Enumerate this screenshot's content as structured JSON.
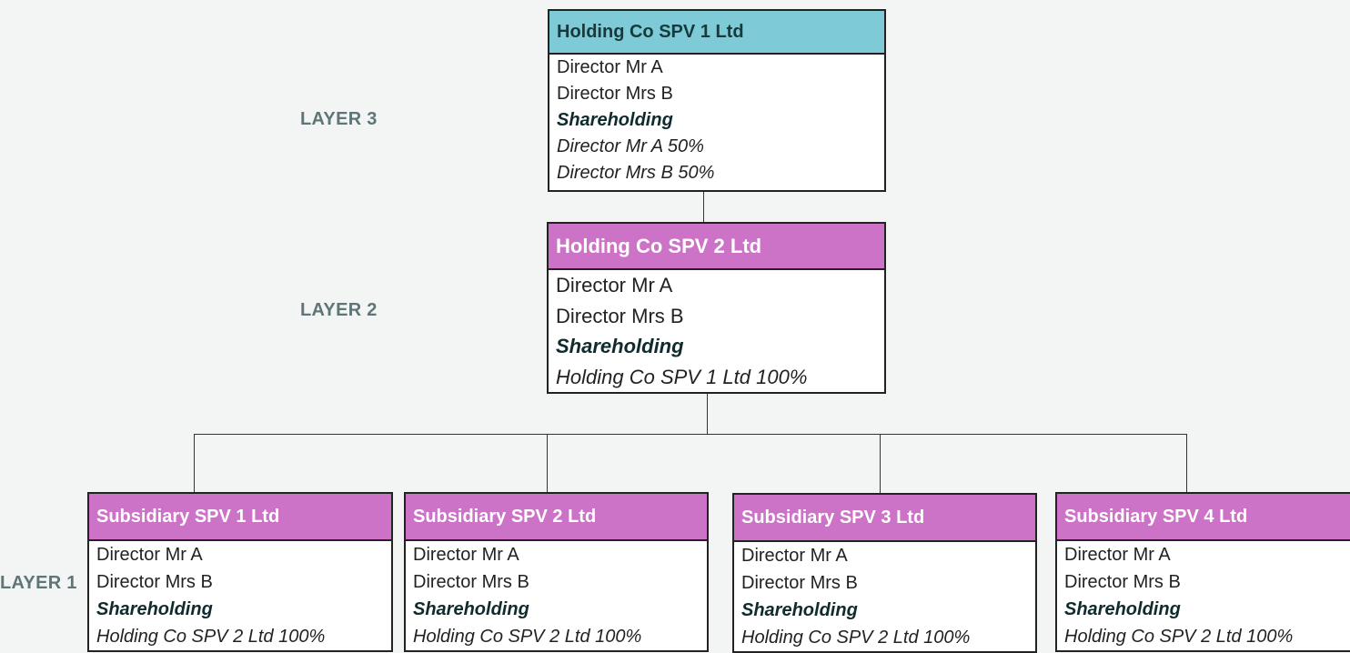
{
  "colors": {
    "top_header": "#7fcad7",
    "sub_header": "#cc73c8",
    "layer_label": "#5f7577",
    "background": "#f3f4f4"
  },
  "layers": {
    "layer3": "LAYER 3",
    "layer2": "LAYER 2",
    "layer1": "LAYER 1"
  },
  "top": {
    "title": "Holding Co SPV 1 Ltd",
    "rows": [
      "Director Mr A",
      "Director Mrs B"
    ],
    "shareholding": "Shareholding",
    "owners": [
      "Director Mr A 50%",
      "Director Mrs B 50%"
    ]
  },
  "mid": {
    "title": "Holding Co SPV 2 Ltd",
    "rows": [
      "Director Mr A",
      "Director Mrs B"
    ],
    "shareholding": "Shareholding",
    "owners": [
      "Holding Co SPV 1 Ltd 100%"
    ]
  },
  "subs": [
    {
      "title": "Subsidiary SPV 1 Ltd",
      "rows": [
        "Director Mr A",
        "Director Mrs B"
      ],
      "shareholding": "Shareholding",
      "owner": "Holding Co SPV 2 Ltd 100%"
    },
    {
      "title": "Subsidiary SPV 2 Ltd",
      "rows": [
        "Director Mr A",
        "Director Mrs B"
      ],
      "shareholding": "Shareholding",
      "owner": "Holding Co SPV 2 Ltd 100%"
    },
    {
      "title": "Subsidiary SPV 3 Ltd",
      "rows": [
        "Director Mr A",
        "Director Mrs B"
      ],
      "shareholding": "Shareholding",
      "owner": "Holding Co SPV 2 Ltd 100%"
    },
    {
      "title": "Subsidiary SPV 4 Ltd",
      "rows": [
        "Director Mr A",
        "Director Mrs B"
      ],
      "shareholding": "Shareholding",
      "owner": "Holding Co SPV 2 Ltd 100%"
    }
  ]
}
